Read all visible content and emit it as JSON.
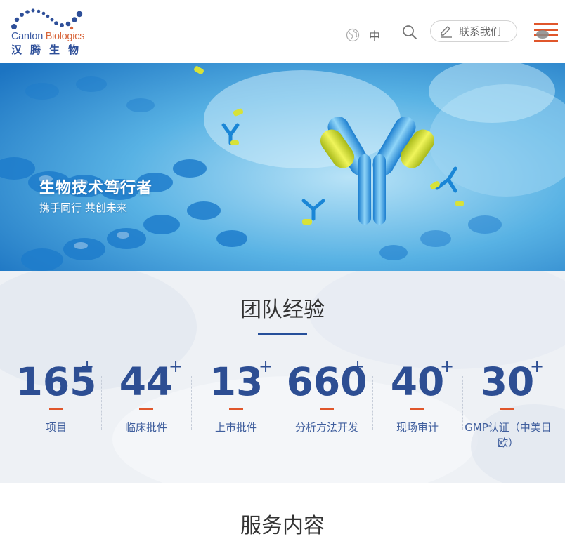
{
  "header": {
    "logo_en_prefix": "Canton ",
    "logo_en_suffix": "Biologics",
    "logo_cn": "汉腾生物",
    "language": "中",
    "contact_label": "联系我们"
  },
  "banner": {
    "title": "生物技术笃行者",
    "subtitle": "携手同行 共创未来",
    "slide_count": 3,
    "active_slide": 2
  },
  "team": {
    "title": "团队经验",
    "stats": [
      {
        "value": "165",
        "suffix": "+",
        "label": "项目"
      },
      {
        "value": "44",
        "suffix": "+",
        "label": "临床批件"
      },
      {
        "value": "13",
        "suffix": "+",
        "label": "上市批件"
      },
      {
        "value": "660",
        "suffix": "+",
        "label": "分析方法开发"
      },
      {
        "value": "40",
        "suffix": "+",
        "label": "现场审计"
      },
      {
        "value": "30",
        "suffix": "+",
        "label": "GMP认证（中美日欧）"
      }
    ]
  },
  "services": {
    "title": "服务内容"
  },
  "colors": {
    "brand_blue": "#2d4e93",
    "accent_orange": "#e0562b"
  }
}
